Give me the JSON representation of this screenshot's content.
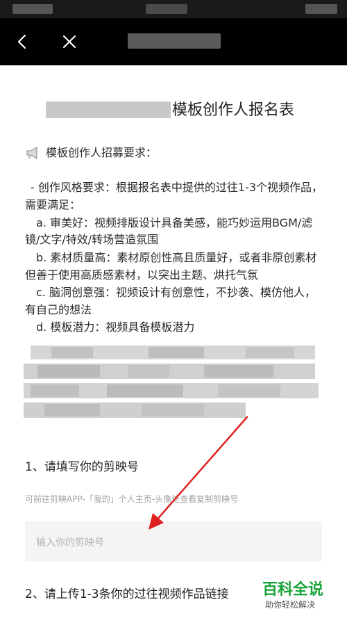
{
  "header": {
    "back_icon": "back-arrow-icon",
    "close_icon": "close-icon"
  },
  "form": {
    "title": "模板创作人报名表",
    "recruit_heading": "模板创作人招募要求：",
    "requirements": [
      "- 创作风格要求：根据报名表中提供的过往1-3个视频作品，",
      "需要满足：",
      "a. 审美好：视频排版设计具备美感，能巧妙运用BGM/滤",
      "镜/文字/特效/转场营造氛围",
      "b. 素材质量高：素材原创性高且质量好，或者非原创素材",
      "但善于使用高质感素材，以突出主题、烘托气氛",
      "c. 脑洞创意强：视频设计有创意性，不抄袭、模仿他人，",
      "有自己的想法",
      "d. 模板潜力：视频具备模板潜力"
    ],
    "q1_title": "1、请填写你的剪映号",
    "q1_hint": "可前往剪映APP-「我的」个人主页-头像处查看复制剪映号",
    "q1_placeholder": "输入你的剪映号",
    "q2_title": "2、请上传1-3条你的过往视频作品链接"
  },
  "watermark": {
    "main": "百科全说",
    "sub": "助你轻松解决"
  },
  "colors": {
    "navbar": "#000000",
    "annotation_arrow": "#e02020",
    "watermark_green": "#1aa33a"
  }
}
